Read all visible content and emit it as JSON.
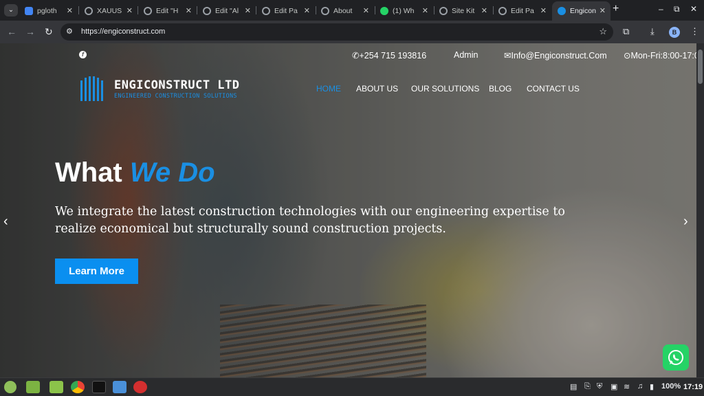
{
  "browser": {
    "tabs": [
      {
        "title": "pgloth",
        "favicon_color": "#4285f4"
      },
      {
        "title": "XAUUS",
        "favicon_color": "#9aa0a6"
      },
      {
        "title": "Edit \"H",
        "favicon_color": "#9aa0a6"
      },
      {
        "title": "Edit \"Al",
        "favicon_color": "#9aa0a6"
      },
      {
        "title": "Edit Pa",
        "favicon_color": "#9aa0a6"
      },
      {
        "title": "About",
        "favicon_color": "#9aa0a6"
      },
      {
        "title": "(1) Wh",
        "favicon_color": "#25d366"
      },
      {
        "title": "Site Kit",
        "favicon_color": "#9aa0a6"
      },
      {
        "title": "Edit Pa",
        "favicon_color": "#9aa0a6"
      },
      {
        "title": "Engicon",
        "favicon_color": "#1a8fe3"
      }
    ],
    "active_tab_index": 9,
    "url": "https://engiconstruct.com",
    "profile_initial": "B"
  },
  "site": {
    "topbar": {
      "phone": "+254 715 193816",
      "admin": "Admin",
      "email": "Info@Engiconstruct.Com",
      "hours": "Mon-Fri:8:00-17:0"
    },
    "brand": {
      "name": "ENGICONSTRUCT LTD",
      "tagline": "ENGINEERED CONSTRUCTION SOLUTIONS"
    },
    "nav": [
      "HOME",
      "ABOUT US",
      "OUR SOLUTIONS",
      "BLOG",
      "CONTACT US"
    ],
    "hero": {
      "title_plain": "What",
      "title_accent": "We Do",
      "text": "We integrate the latest construction technologies with our engineering expertise to realize economical but structurally sound construction projects.",
      "cta": "Learn More"
    },
    "accent_color": "#1a8fe3"
  },
  "taskbar": {
    "battery": "100%",
    "clock": "17:19"
  }
}
